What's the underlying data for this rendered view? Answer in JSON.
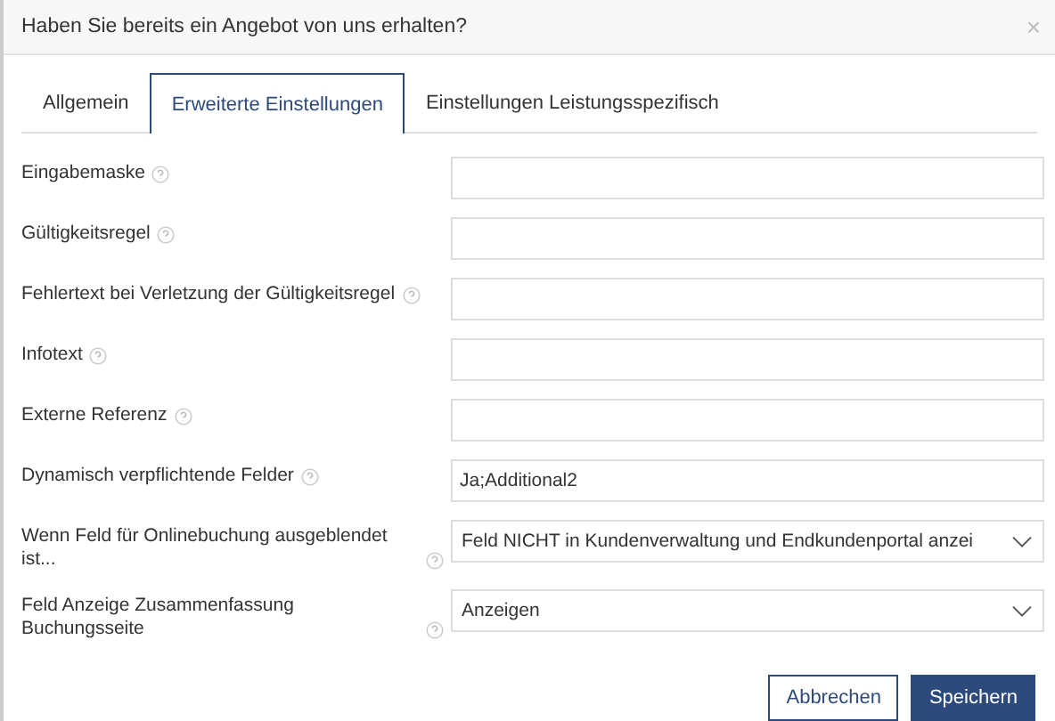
{
  "dialog": {
    "title": "Haben Sie bereits ein Angebot von uns erhalten?",
    "close": "×"
  },
  "tabs": [
    {
      "label": "Allgemein",
      "selected": false
    },
    {
      "label": "Erweiterte Einstellungen",
      "selected": true
    },
    {
      "label": "Einstellungen Leistungsspezifisch",
      "selected": false
    }
  ],
  "fields": [
    {
      "label": "Eingabemaske",
      "kind": "text"
    },
    {
      "label": "Gültigkeitsregel",
      "kind": "text"
    },
    {
      "label": "Fehlertext bei Verletzung der Gültigkeitsregel",
      "kind": "text"
    },
    {
      "label": "Infotext",
      "kind": "text"
    },
    {
      "label": "Externe Referenz",
      "kind": "text"
    },
    {
      "label": "Dynamisch verpflichtende Felder",
      "kind": "text",
      "value": "Ja;Additional2"
    },
    {
      "label": "Wenn Feld für Onlinebuchung ausgeblendet ist...",
      "kind": "select",
      "value": "Feld NICHT in Kundenverwaltung und Endkundenportal anzei"
    },
    {
      "label": "Feld Anzeige Zusammenfassung Buchungsseite",
      "kind": "select",
      "value": "Anzeigen"
    }
  ],
  "buttons": [
    {
      "label": "Abbrechen",
      "kind": "secondary"
    },
    {
      "label": "Speichern",
      "kind": "primary"
    }
  ]
}
